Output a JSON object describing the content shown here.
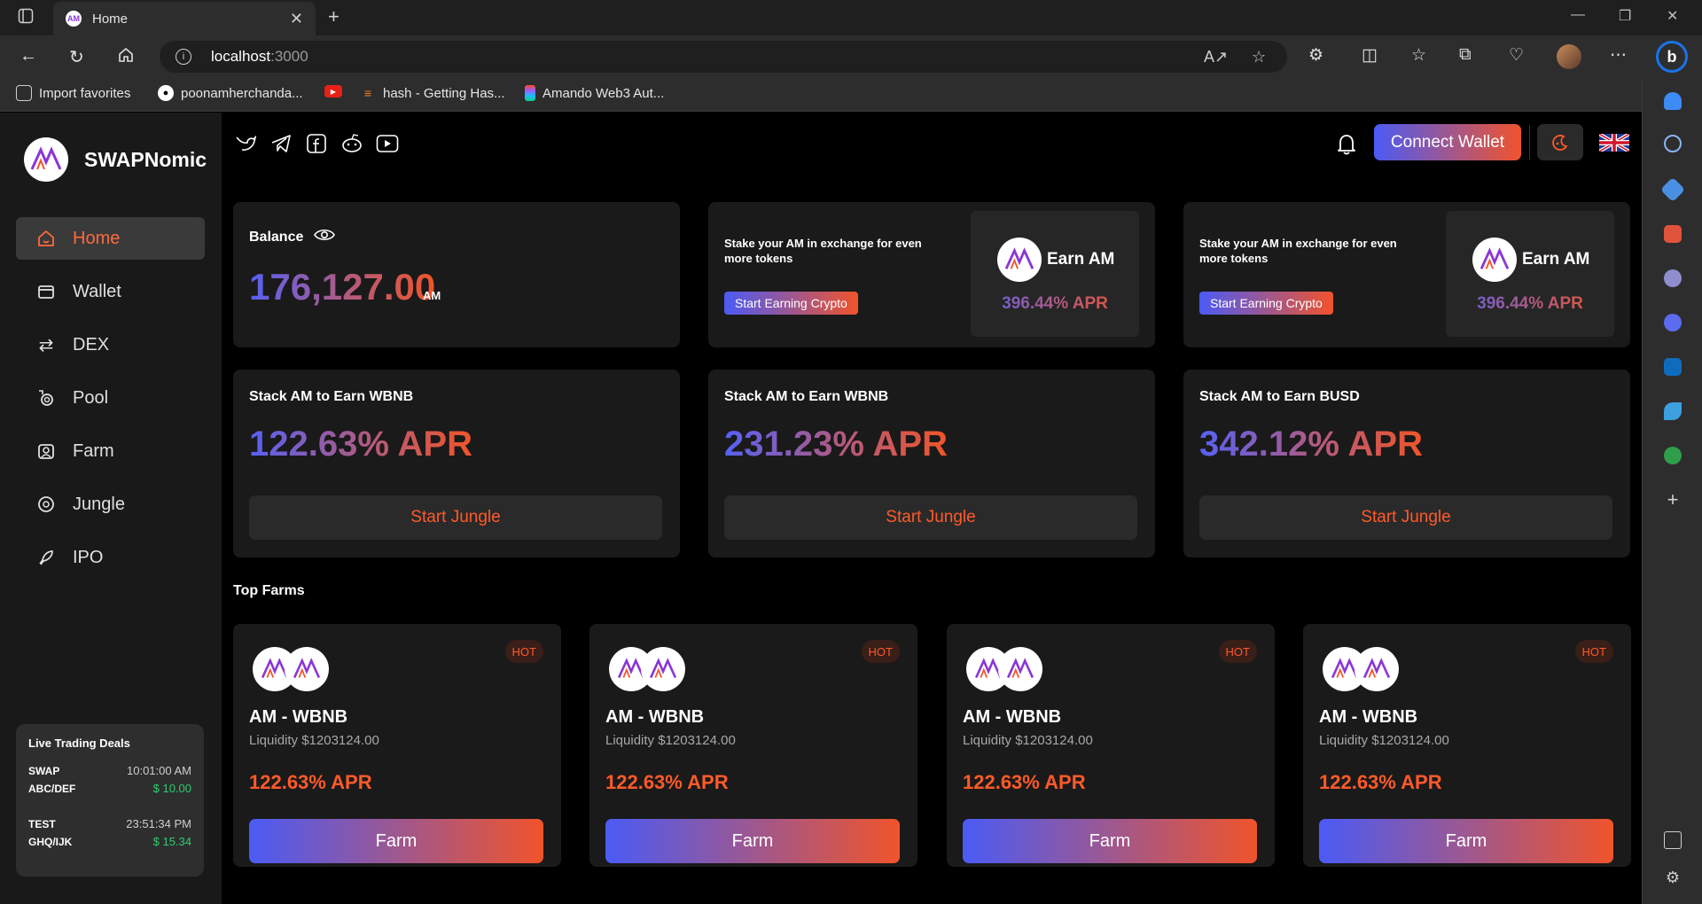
{
  "browser": {
    "tab_title": "Home",
    "url_host": "localhost",
    "url_port": ":3000",
    "favorites": [
      {
        "label": "Import favorites"
      },
      {
        "label": "poonamherchanda..."
      },
      {
        "label": "hash - Getting Has..."
      },
      {
        "label": "Amando Web3 Aut..."
      }
    ]
  },
  "brand": {
    "name": "SWAPNomic",
    "logo_text": "AM"
  },
  "sidebar": {
    "items": [
      {
        "label": "Home",
        "icon": "home-icon"
      },
      {
        "label": "Wallet",
        "icon": "wallet-icon"
      },
      {
        "label": "DEX",
        "icon": "swap-arrows-icon"
      },
      {
        "label": "Pool",
        "icon": "pool-icon"
      },
      {
        "label": "Farm",
        "icon": "farm-icon"
      },
      {
        "label": "Jungle",
        "icon": "jungle-icon"
      },
      {
        "label": "IPO",
        "icon": "rocket-icon"
      }
    ],
    "deals": {
      "title": "Live Trading Deals",
      "rows": [
        {
          "type": "SWAP",
          "pair": "ABC/DEF",
          "time": "10:01:00 AM",
          "amount": "$ 10.00"
        },
        {
          "type": "TEST",
          "pair": "GHQ/IJK",
          "time": "23:51:34 PM",
          "amount": "$ 15.34"
        }
      ]
    }
  },
  "header": {
    "connect_label": "Connect Wallet",
    "social": [
      "twitter-icon",
      "telegram-icon",
      "facebook-icon",
      "reddit-icon",
      "youtube-icon"
    ]
  },
  "balance": {
    "title": "Balance",
    "value": "176,127.00",
    "unit": "AM"
  },
  "earn_cards": [
    {
      "text": "Stake your AM in exchange for even more tokens",
      "button": "Start Earning Crypto",
      "label": "Earn AM",
      "apr": "396.44% APR"
    },
    {
      "text": "Stake your AM in exchange for even more tokens",
      "button": "Start Earning Crypto",
      "label": "Earn AM",
      "apr": "396.44% APR"
    }
  ],
  "jungle_cards": [
    {
      "title": "Stack AM to Earn WBNB",
      "apr": "122.63% APR",
      "button": "Start Jungle"
    },
    {
      "title": "Stack AM to Earn WBNB",
      "apr": "231.23% APR",
      "button": "Start Jungle"
    },
    {
      "title": "Stack AM to Earn BUSD",
      "apr": "342.12% APR",
      "button": "Start Jungle"
    }
  ],
  "top_farms": {
    "title": "Top Farms",
    "items": [
      {
        "badge": "HOT",
        "name": "AM - WBNB",
        "liquidity": "Liquidity $1203124.00",
        "apr": "122.63% APR",
        "button": "Farm"
      },
      {
        "badge": "HOT",
        "name": "AM - WBNB",
        "liquidity": "Liquidity $1203124.00",
        "apr": "122.63% APR",
        "button": "Farm"
      },
      {
        "badge": "HOT",
        "name": "AM - WBNB",
        "liquidity": "Liquidity $1203124.00",
        "apr": "122.63% APR",
        "button": "Farm"
      },
      {
        "badge": "HOT",
        "name": "AM - WBNB",
        "liquidity": "Liquidity $1203124.00",
        "apr": "122.63% APR",
        "button": "Farm"
      }
    ]
  },
  "colors": {
    "accent": "#ff5a2a",
    "gradient_start": "#4b5bf5",
    "gradient_end": "#f0542b",
    "positive": "#2ecc71"
  }
}
